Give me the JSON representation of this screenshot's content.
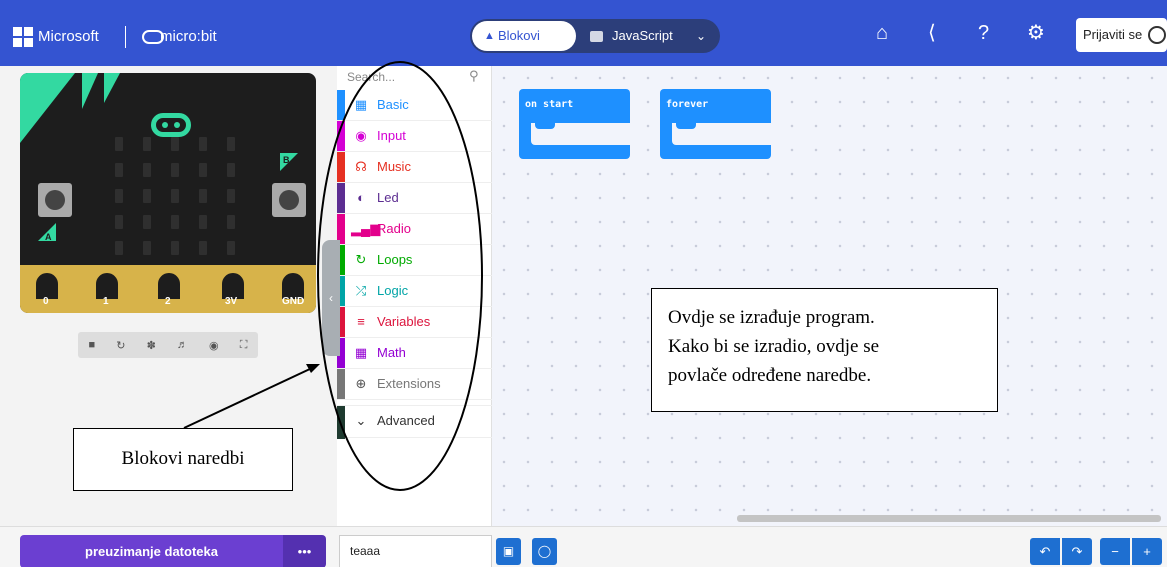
{
  "header": {
    "brand": "Microsoft",
    "product": "micro:bit",
    "tabs": {
      "blocks": "Blokovi",
      "javascript": "JavaScript"
    },
    "login": "Prijaviti se"
  },
  "simulator": {
    "pins": [
      "0",
      "1",
      "2",
      "3V",
      "GND"
    ],
    "button_a": "A",
    "button_b": "B"
  },
  "toolbox": {
    "search_placeholder": "Search...",
    "categories": [
      {
        "label": "Basic",
        "color": "#1e90ff",
        "icon": "grid-icon"
      },
      {
        "label": "Input",
        "color": "#d400d4",
        "icon": "circle-icon"
      },
      {
        "label": "Music",
        "color": "#e63022",
        "icon": "headphones-icon"
      },
      {
        "label": "Led",
        "color": "#5c2d91",
        "icon": "toggle-icon"
      },
      {
        "label": "Radio",
        "color": "#e3008c",
        "icon": "signal-icon"
      },
      {
        "label": "Loops",
        "color": "#00aa00",
        "icon": "refresh-icon"
      },
      {
        "label": "Logic",
        "color": "#00a4a6",
        "icon": "shuffle-icon"
      },
      {
        "label": "Variables",
        "color": "#dc143c",
        "icon": "list-icon"
      },
      {
        "label": "Math",
        "color": "#9400d3",
        "icon": "calculator-icon"
      },
      {
        "label": "Extensions",
        "color": "#777777",
        "icon": "plus-circle-icon"
      }
    ],
    "advanced": "Advanced"
  },
  "workspace": {
    "blocks": [
      "on start",
      "forever"
    ]
  },
  "annotations": {
    "workspace_note": [
      "Ovdje se izrađuje program.",
      "Kako bi se izradio, ovdje se",
      "povlače određene naredbe."
    ],
    "blocks_note": "Blokovi naredbi"
  },
  "bottom": {
    "download": "preuzimanje datoteka",
    "more": "•••",
    "project_name": "teaaa"
  }
}
